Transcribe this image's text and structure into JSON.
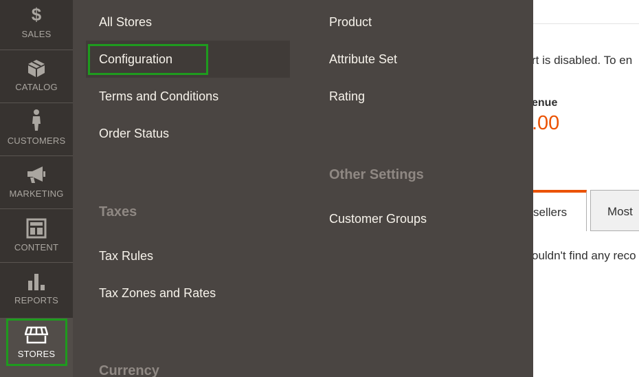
{
  "dashboard": {
    "notice_text": "rt is disabled. To en",
    "revenue_label": "enue",
    "revenue_value": ".00",
    "tabs": [
      {
        "label": "sellers"
      },
      {
        "label": "Most"
      }
    ],
    "empty_text": "ouldn't find any reco"
  },
  "nav": {
    "items": [
      {
        "label": "SALES",
        "icon": "dollar-icon"
      },
      {
        "label": "CATALOG",
        "icon": "box-icon"
      },
      {
        "label": "CUSTOMERS",
        "icon": "person-icon"
      },
      {
        "label": "MARKETING",
        "icon": "megaphone-icon"
      },
      {
        "label": "CONTENT",
        "icon": "layout-icon"
      },
      {
        "label": "REPORTS",
        "icon": "bar-chart-icon"
      },
      {
        "label": "STORES",
        "icon": "storefront-icon"
      }
    ],
    "active": "STORES"
  },
  "flyout": {
    "settings": {
      "links": [
        "All Stores",
        "Configuration",
        "Terms and Conditions",
        "Order Status"
      ]
    },
    "taxes": {
      "heading": "Taxes",
      "links": [
        "Tax Rules",
        "Tax Zones and Rates"
      ]
    },
    "currency": {
      "heading": "Currency"
    },
    "attributes": {
      "links": [
        "Product",
        "Attribute Set",
        "Rating"
      ]
    },
    "other": {
      "heading": "Other Settings",
      "links": [
        "Customer Groups"
      ]
    }
  },
  "colors": {
    "accent": "#eb5202",
    "highlight": "#1e9b1e",
    "nav_bg": "#373330",
    "flyout_bg": "#4a4542"
  }
}
